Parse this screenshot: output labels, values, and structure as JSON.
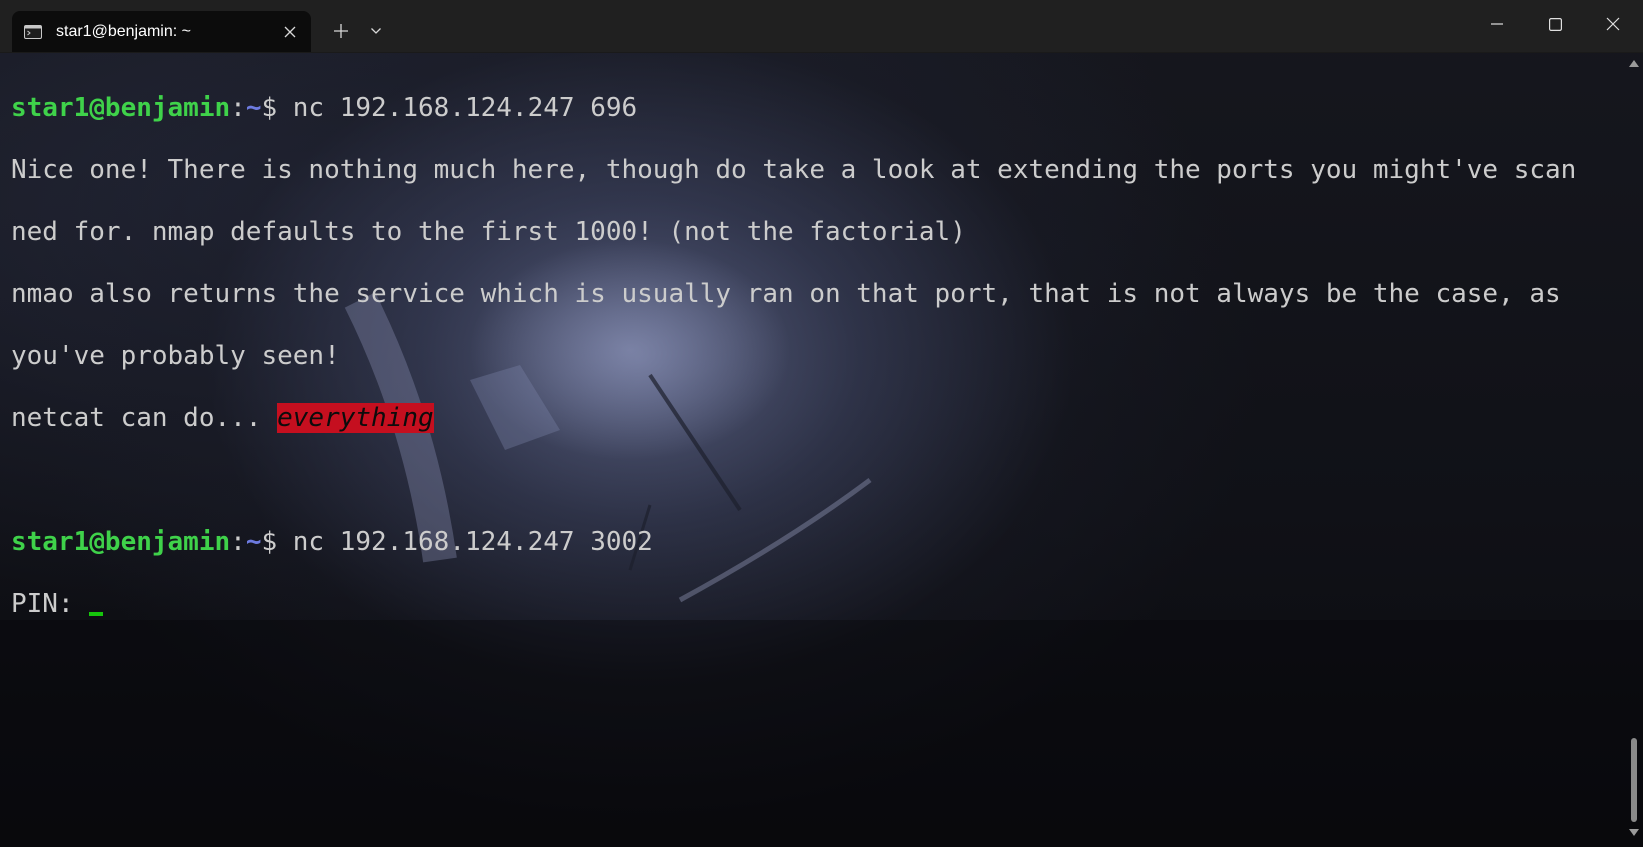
{
  "tab": {
    "icon": "terminal-icon",
    "title": "star1@benjamin: ~",
    "close_icon": "close-icon"
  },
  "titlebar": {
    "new_tab_icon": "plus-icon",
    "dropdown_icon": "chevron-down-icon",
    "minimize_icon": "minimize-icon",
    "maximize_icon": "maximize-icon",
    "close_icon": "close-icon"
  },
  "terminal": {
    "prompt_user": "star1@benjamin",
    "prompt_sep": ":",
    "prompt_path": "~",
    "prompt_dollar": "$ ",
    "command1": "nc 192.168.124.247 696",
    "output1_line1": "Nice one! There is nothing much here, though do take a look at extending the ports you might've scan",
    "output1_line2": "ned for. nmap defaults to the first 1000! (not the factorial)",
    "output1_line3": "nmao also returns the service which is usually ran on that port, that is not always be the case, as",
    "output1_line4": "you've probably seen!",
    "output1_line5_prefix": "netcat can do... ",
    "output1_line5_highlight": "everything",
    "command2": "nc 192.168.124.247 3002",
    "pin_prompt": "PIN: "
  },
  "colors": {
    "prompt_user": "#3fd24a",
    "prompt_path": "#6d7be0",
    "text": "#cccccc",
    "highlight_bg": "#c50f1f",
    "cursor": "#16c60c"
  }
}
